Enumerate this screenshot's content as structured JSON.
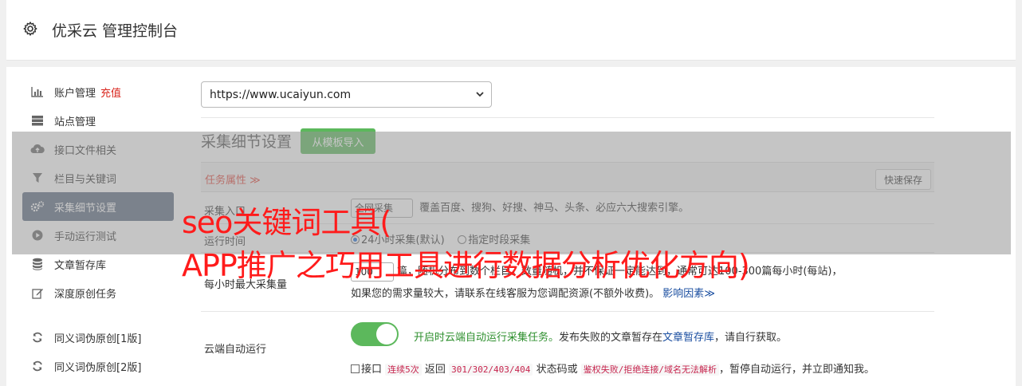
{
  "header": {
    "title": "优采云 管理控制台",
    "icon": "gear-icon"
  },
  "sidebar": {
    "items": [
      {
        "label": "账户管理",
        "extra": "充值",
        "icon": "bar-chart-icon"
      },
      {
        "label": "站点管理",
        "icon": "server-icon"
      },
      {
        "label": "接口文件相关",
        "icon": "cloud-upload-icon"
      },
      {
        "label": "栏目与关键词",
        "icon": "filter-icon"
      },
      {
        "label": "采集细节设置",
        "icon": "cogs-icon",
        "active": true
      },
      {
        "label": "手动运行测试",
        "icon": "play-circle-icon"
      },
      {
        "label": "文章暂存库",
        "icon": "database-icon"
      },
      {
        "label": "深度原创任务",
        "icon": "edit-icon"
      },
      {
        "label": "同义词伪原创[1版]",
        "icon": "refresh-icon"
      },
      {
        "label": "同义词伪原创[2版]",
        "icon": "refresh-icon"
      }
    ]
  },
  "main": {
    "site_select": "https://www.ucaiyun.com",
    "section_title": "采集细节设置",
    "import_button": "从模板导入",
    "task_label": "任务属性",
    "save_button": "快速保存",
    "rows": {
      "source": {
        "label": "采集入口",
        "select": "全网采集",
        "desc": "覆盖百度、搜狗、好搜、神马、头条、必应六大搜索引擎。"
      },
      "runtime": {
        "label": "运行时间",
        "opt1": "24小时采集(默认)",
        "opt2": "指定时段采集"
      },
      "max": {
        "label": "每小时最大采集量",
        "value": "100",
        "line1": "篇，随机分布到数个栏目。数量随机，并不保证一定能达到，通常可达100-300篇每小时(每站)，",
        "line2": "如果您的需求量较大，请联系在线客服为您调配资源(不额外收费)。",
        "link": "影响因素"
      },
      "cloud": {
        "label": "云端自动运行",
        "toggle_text": "开启时云端自动运行采集任务。",
        "desc_pre": "发布失败的文章暂存在",
        "desc_link": "文章暂存库",
        "desc_post": "，请自行获取。",
        "chk_label": "接口",
        "code1": "连续5次",
        "mid1": "返回",
        "code2": "301/302/403/404",
        "mid2": "状态码或",
        "code3": "鉴权失败/拒绝连接/域名无法解析",
        "tail": "，暂停自动运行，并立即通知我。"
      }
    }
  },
  "watermark": {
    "line1": "seo关键词工具(",
    "line2": "APP推广之巧用工具进行数据分析优化方向)"
  },
  "colors": {
    "accent_green": "#5cb85c",
    "active_nav": "#5c6a80",
    "alert_red": "#d9251d"
  }
}
